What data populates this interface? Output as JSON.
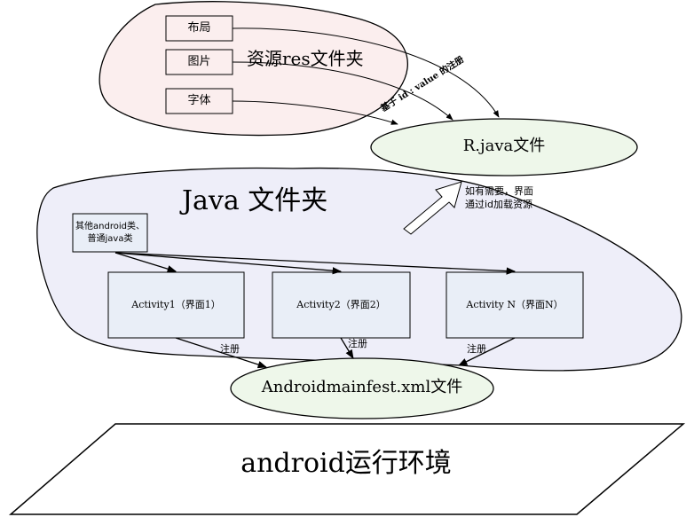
{
  "res_folder": {
    "title": "资源res文件夹",
    "items": [
      "布局",
      "图片",
      "字体"
    ]
  },
  "rjava": {
    "label": "R.java文件"
  },
  "binding_note": "基于 id : value 的注册",
  "load_note": [
    "如有需要，界面",
    "通过id加载资源"
  ],
  "java_folder": {
    "title": "Java 文件夹",
    "other_classes": [
      "其他android类、",
      "普通java类"
    ],
    "activities": [
      "Activity1（界面1）",
      "Activity2（界面2）",
      "Activity N（界面N）"
    ]
  },
  "register_label": "注册",
  "manifest": {
    "label": "Androidmainfest.xml文件"
  },
  "runtime": {
    "label": "android运行环境"
  },
  "colors": {
    "res_fill": "#fbeeee",
    "java_fill": "#eeeef9",
    "ellipse_fill": "#eef7ea",
    "box_fill": "#e9eef7",
    "line": "#000000"
  }
}
